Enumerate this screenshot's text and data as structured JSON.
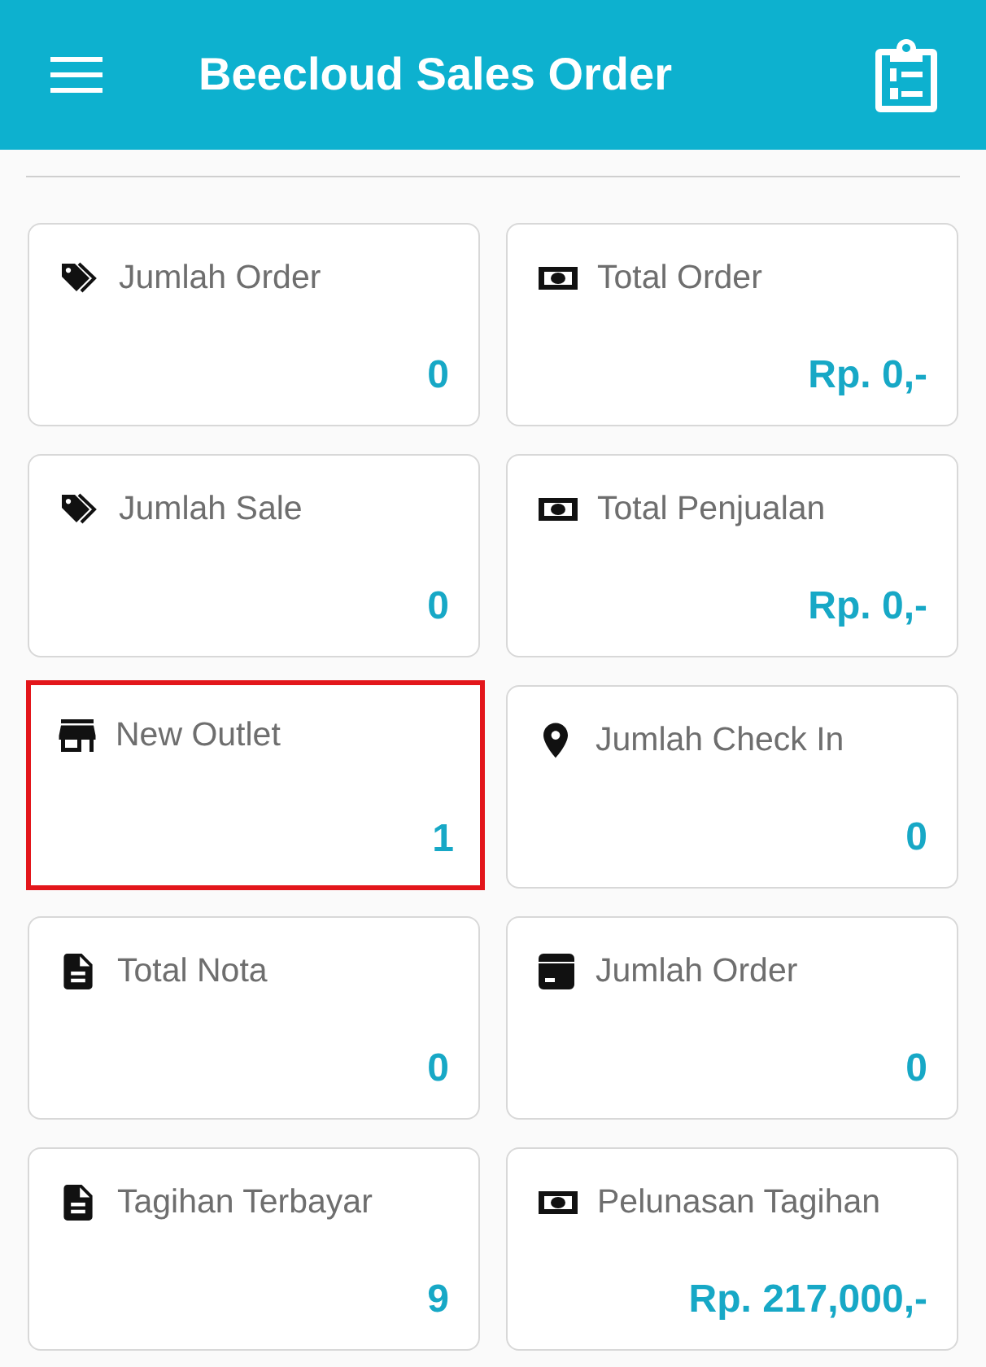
{
  "app_bar": {
    "title": "Beecloud Sales Order"
  },
  "cards": [
    {
      "kind": "tags",
      "label": "Jumlah Order",
      "value": "0",
      "highlighted": false
    },
    {
      "kind": "money",
      "label": "Total Order",
      "value": "Rp. 0,-",
      "highlighted": false
    },
    {
      "kind": "tags",
      "label": "Jumlah Sale",
      "value": "0",
      "highlighted": false
    },
    {
      "kind": "money",
      "label": "Total Penjualan",
      "value": "Rp. 0,-",
      "highlighted": false
    },
    {
      "kind": "store",
      "label": "New Outlet",
      "value": "1",
      "highlighted": true
    },
    {
      "kind": "pin",
      "label": "Jumlah Check In",
      "value": "0",
      "highlighted": false
    },
    {
      "kind": "document",
      "label": "Total Nota",
      "value": "0",
      "highlighted": false
    },
    {
      "kind": "box",
      "label": "Jumlah Order",
      "value": "0",
      "highlighted": false
    },
    {
      "kind": "document",
      "label": "Tagihan Terbayar",
      "value": "9",
      "highlighted": false
    },
    {
      "kind": "money",
      "label": "Pelunasan Tagihan",
      "value": "Rp. 217,000,-",
      "highlighted": false
    }
  ]
}
